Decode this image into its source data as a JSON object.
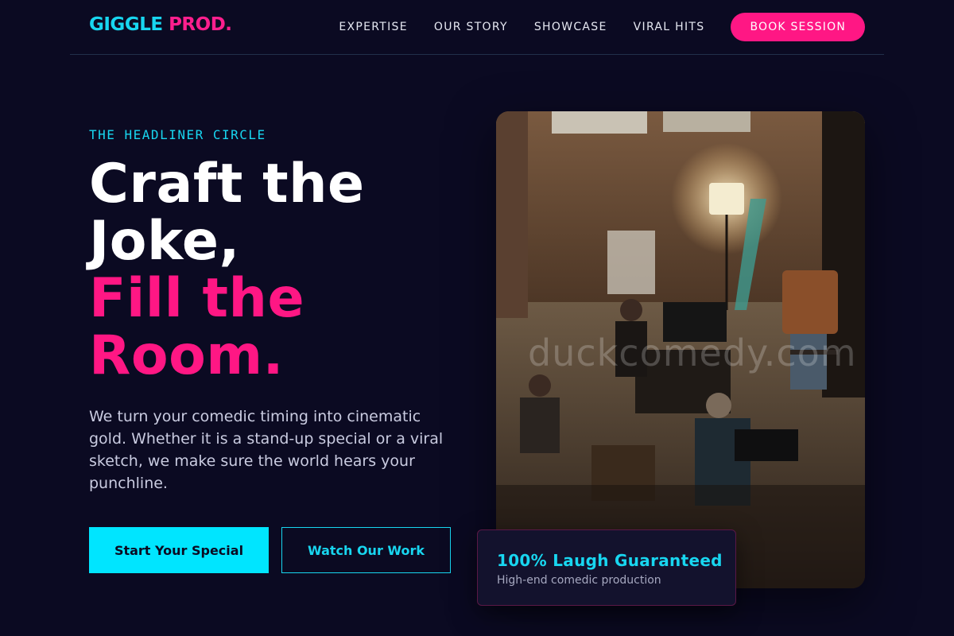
{
  "brand": {
    "part1": "GIGGLE",
    "part2": "PROD."
  },
  "nav": {
    "items": [
      {
        "label": "EXPERTISE"
      },
      {
        "label": "OUR STORY"
      },
      {
        "label": "SHOWCASE"
      },
      {
        "label": "VIRAL HITS"
      }
    ],
    "cta": "BOOK SESSION"
  },
  "hero": {
    "eyebrow": "THE HEADLINER CIRCLE",
    "headline": {
      "line1": "Craft the",
      "line2": "Joke,",
      "line3": "Fill the",
      "line4": "Room."
    },
    "lead": "We turn your comedic timing into cinematic gold. Whether it is a stand-up special or a viral sketch, we make sure the world hears your punchline.",
    "primary_button": "Start Your Special",
    "secondary_button": "Watch Our Work",
    "image_watermark": "duckcomedy.com"
  },
  "badge": {
    "title": "100% Laugh Guaranteed",
    "subtitle": "High-end comedic production"
  },
  "colors": {
    "accent_cyan": "#00e5ff",
    "accent_pink": "#ff1784",
    "background": "#0b0a22"
  }
}
